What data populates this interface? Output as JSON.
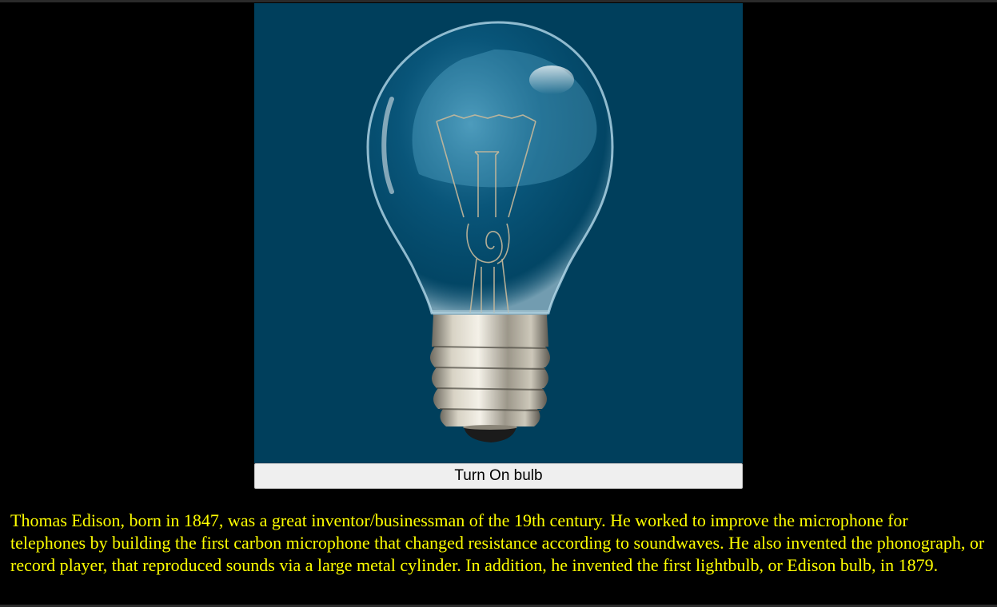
{
  "bulb": {
    "image_icon": "lightbulb-off-icon",
    "panel_color": "#003f5c",
    "state": "off"
  },
  "toggle": {
    "label": "Turn On bulb"
  },
  "description": {
    "text": "Thomas Edison, born in 1847, was a great inventor/businessman of the 19th century. He worked to improve the microphone for telephones by building the first carbon microphone that changed resistance according to soundwaves. He also invented the phonograph, or record player, that reproduced sounds via a large metal cylinder. In addition, he invented the first lightbulb, or Edison bulb, in 1879.",
    "color": "#ffff00"
  }
}
